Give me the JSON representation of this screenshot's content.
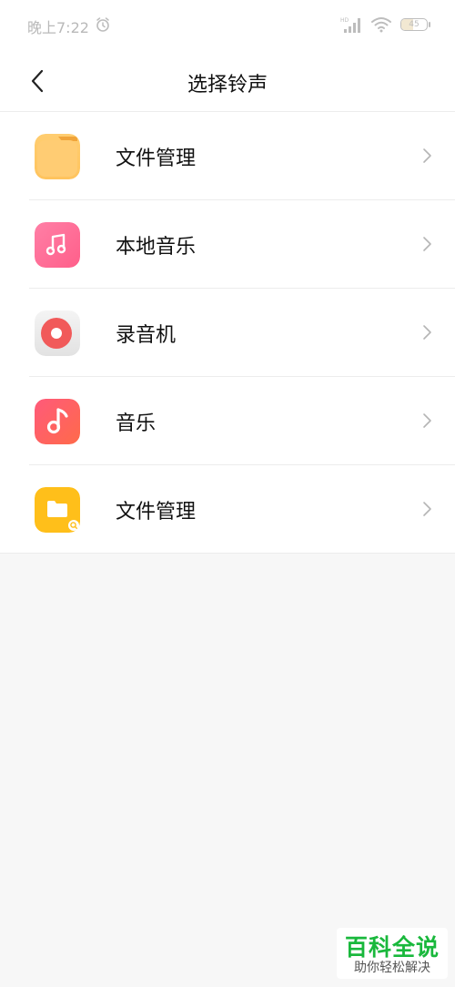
{
  "status_bar": {
    "time": "晚上7:22",
    "battery_level": "45",
    "battery_fraction": 0.45,
    "icons": [
      "alarm-icon",
      "hd-signal-icon",
      "wifi-icon",
      "battery-icon"
    ]
  },
  "header": {
    "title": "选择铃声",
    "back_icon": "chevron-left-icon"
  },
  "items": [
    {
      "label": "文件管理",
      "icon": "folder-app-icon"
    },
    {
      "label": "本地音乐",
      "icon": "music-note-app-icon"
    },
    {
      "label": "录音机",
      "icon": "recorder-app-icon"
    },
    {
      "label": "音乐",
      "icon": "music-app-icon"
    },
    {
      "label": "文件管理",
      "icon": "file-manager-app-icon"
    }
  ],
  "watermark": {
    "main": "百科全说",
    "sub": "助你轻松解决"
  },
  "colors": {
    "accent_green": "#19b83c",
    "background": "#f7f7f7"
  }
}
